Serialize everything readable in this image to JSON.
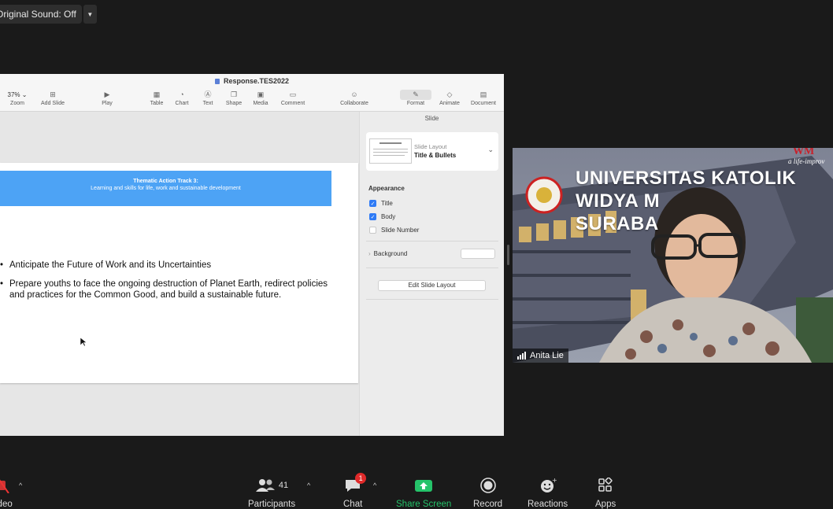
{
  "audio": {
    "original_sound_label": "Original Sound: Off",
    "caret_icon": "chevron-down-icon"
  },
  "keynote": {
    "doc_title": "Response.TES2022",
    "toolbar": {
      "zoom_value": "37%",
      "zoom_label": "Zoom",
      "add_slide": "Add Slide",
      "play": "Play",
      "table": "Table",
      "chart": "Chart",
      "text": "Text",
      "shape": "Shape",
      "media": "Media",
      "comment": "Comment",
      "collaborate": "Collaborate",
      "format": "Format",
      "animate": "Animate",
      "document": "Document"
    },
    "slide": {
      "header_line1": "Thematic Action Track 3:",
      "header_line2": "Learning and skills for life, work and sustainable development",
      "bullets": [
        "Anticipate the Future of Work and its Uncertainties",
        "Prepare youths to face the ongoing destruction of Planet Earth, redirect policies and practices for the Common Good, and build a sustainable future."
      ]
    },
    "sidebar": {
      "title": "Slide",
      "layout_label": "Slide Layout",
      "layout_name": "Title & Bullets",
      "appearance": "Appearance",
      "title_check": "Title",
      "body_check": "Body",
      "slide_number_check": "Slide Number",
      "background": "Background",
      "edit_layout": "Edit Slide Layout"
    }
  },
  "video": {
    "participant_name": "Anita Lie",
    "backdrop_line1": "UNIVERSITAS KATOLIK",
    "backdrop_line2": "WIDYA M",
    "backdrop_line3": "SURABA",
    "brand_mark": "WM",
    "tagline": "a life-improv"
  },
  "bottombar": {
    "video_label": "ideo",
    "participants_label": "Participants",
    "participants_count": "41",
    "chat_label": "Chat",
    "chat_badge": "1",
    "share_label": "Share Screen",
    "record_label": "Record",
    "reactions_label": "Reactions",
    "apps_label": "Apps",
    "share_color": "#25c36a",
    "badge_color": "#e02a2a"
  }
}
